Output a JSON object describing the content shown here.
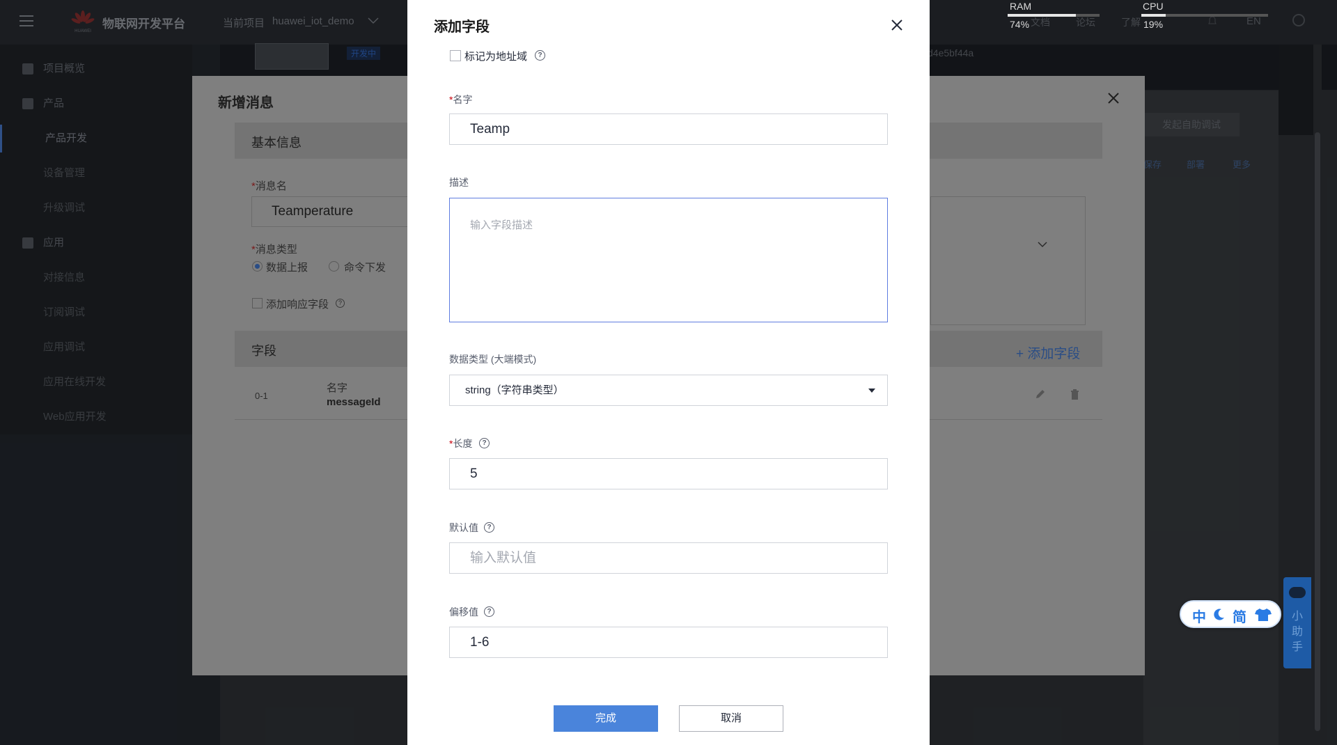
{
  "app": {
    "brand": "物联网开发平台",
    "logo_text": "HUAWEI",
    "project_label": "当前项目",
    "project_name": "huawei_iot_demo",
    "top_items": [
      "文档",
      "论坛",
      "了解"
    ],
    "lang": "EN"
  },
  "sidebar": {
    "items": [
      {
        "label": "项目概览",
        "icon": "home-icon"
      },
      {
        "label": "产品",
        "icon": "product-icon"
      },
      {
        "label": "产品开发",
        "sub": true
      },
      {
        "label": "设备管理",
        "sub": true
      },
      {
        "label": "升级调试",
        "sub": true
      },
      {
        "label": "应用",
        "icon": "apps-icon"
      },
      {
        "label": "对接信息",
        "sub": true
      },
      {
        "label": "订阅调试",
        "sub": true
      },
      {
        "label": "应用调试",
        "sub": true
      },
      {
        "label": "应用在线开发",
        "sub": true
      },
      {
        "label": "Web应用开发",
        "sub": true
      }
    ]
  },
  "background": {
    "tag": "开发中",
    "hash_fragment": "d4e5bf44a",
    "self_test_button": "发起自助调试",
    "toolbar": [
      "保存",
      "部署",
      "更多"
    ]
  },
  "new_message_modal": {
    "title": "新增消息",
    "basic_info": "基本信息",
    "name_label": "消息名",
    "name_value": "Teamperature",
    "type_label": "消息类型",
    "type_options": [
      "数据上报",
      "命令下发"
    ],
    "add_response_label": "添加响应字段",
    "fields_section": "字段",
    "add_field": "添加字段",
    "row": {
      "index": "0-1",
      "key": "名字",
      "value": "messageId"
    }
  },
  "dialog": {
    "title": "添加字段",
    "address_checkbox_label": "标记为地址域",
    "name": {
      "label": "名字",
      "value": "Teamp"
    },
    "description": {
      "label": "描述",
      "placeholder": "输入字段描述"
    },
    "data_type": {
      "label": "数据类型 (大端模式)",
      "value": "string（字符串类型）"
    },
    "length": {
      "label": "长度",
      "value": "5"
    },
    "default_value": {
      "label": "默认值",
      "placeholder": "输入默认值"
    },
    "offset": {
      "label": "偏移值",
      "value": "1-6"
    },
    "buttons": {
      "done": "完成",
      "cancel": "取消"
    }
  },
  "system": {
    "ram_label": "RAM",
    "ram_value": "74%",
    "ram_level": 0.74,
    "cpu_label": "CPU",
    "cpu_value": "19%",
    "cpu_level": 0.19,
    "ime": [
      "中",
      "简"
    ],
    "helper_text": "小助手"
  },
  "colors": {
    "primary": "#4a84db",
    "required": "#c7000b",
    "focus_border": "#5e7ce0"
  }
}
